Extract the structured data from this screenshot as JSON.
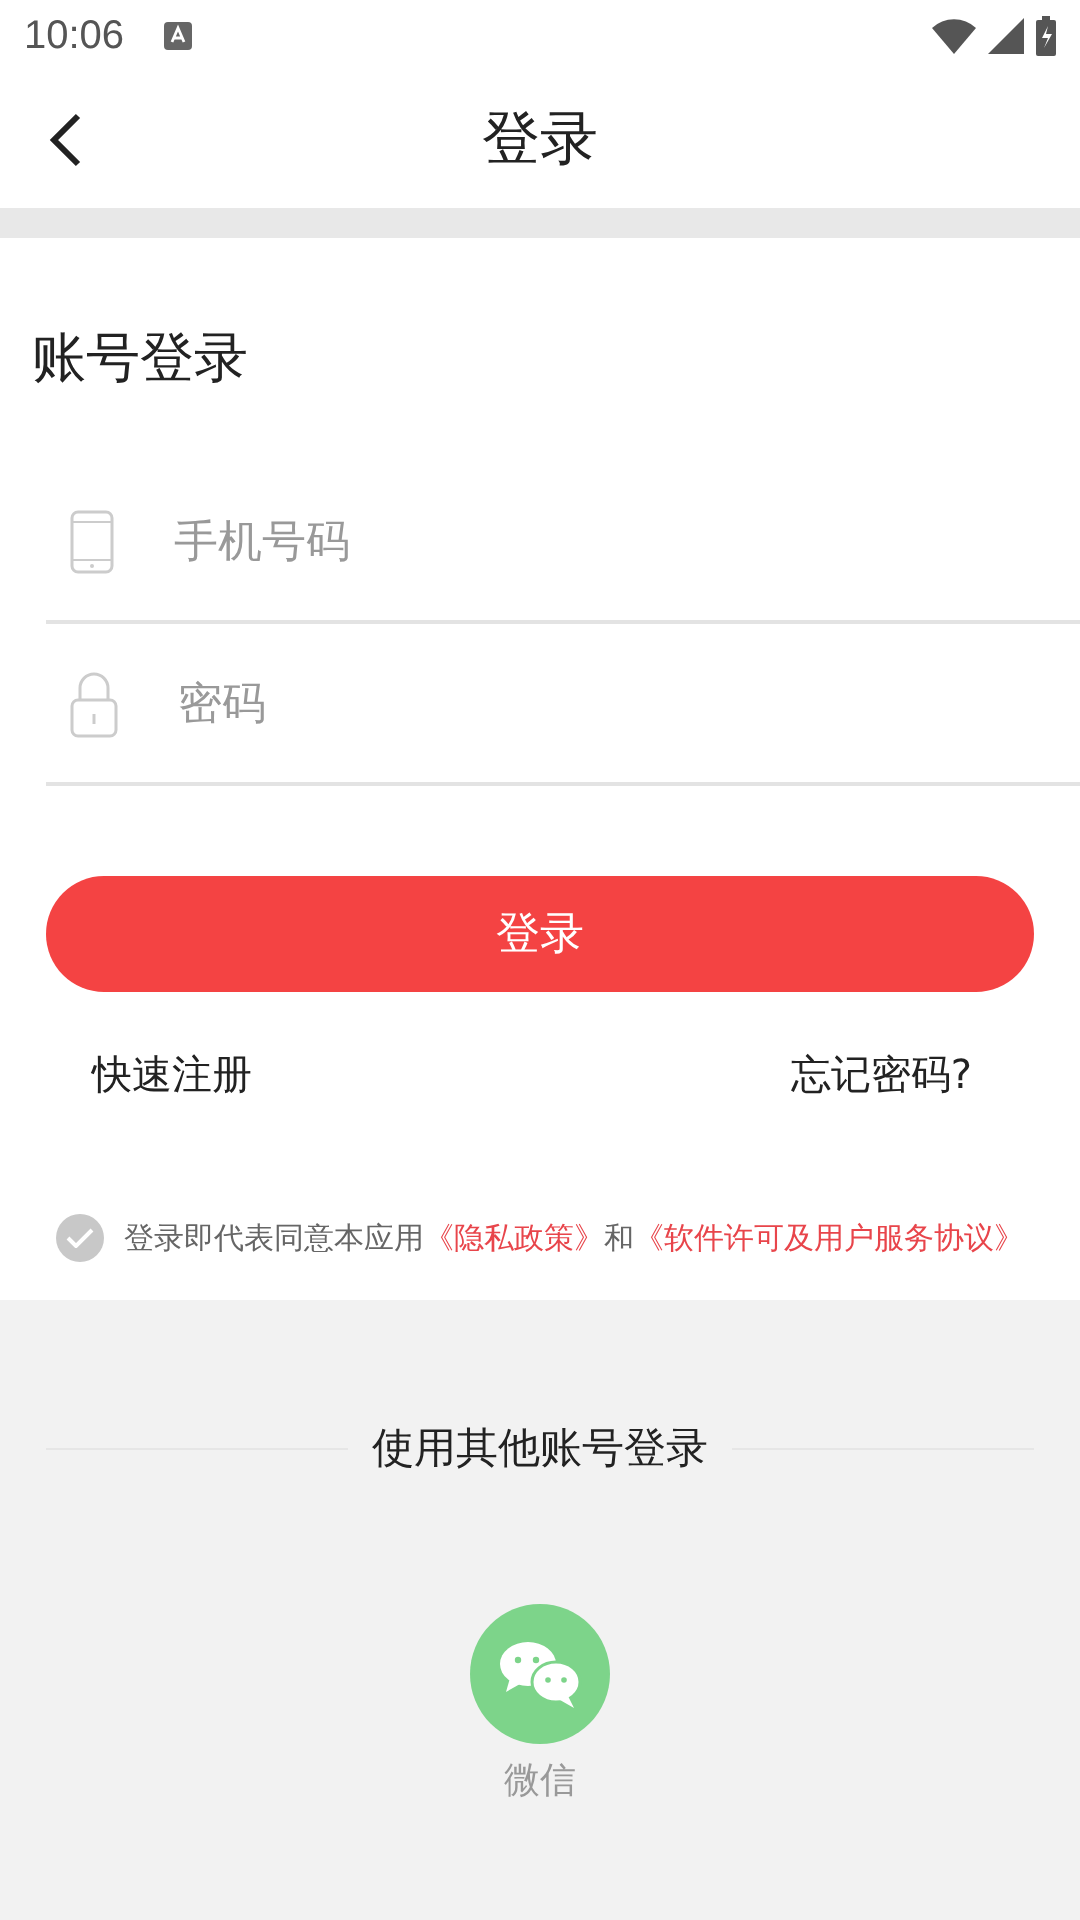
{
  "status_bar": {
    "time": "10:06"
  },
  "header": {
    "title": "登录"
  },
  "section_title": "账号登录",
  "fields": [
    {
      "kind": "phone",
      "placeholder": "手机号码"
    },
    {
      "kind": "password",
      "placeholder": "密码"
    }
  ],
  "login_button": "登录",
  "links": {
    "register": "快速注册",
    "forgot": "忘记密码?"
  },
  "agreement": {
    "checked": false,
    "text": "登录即代表同意本应用",
    "policy": "《隐私政策》",
    "joiner": "和",
    "license": "《软件许可及用户服务协议》"
  },
  "other_login": {
    "title": "使用其他账号登录",
    "providers": [
      {
        "kind": "wechat",
        "label": "微信"
      }
    ]
  }
}
